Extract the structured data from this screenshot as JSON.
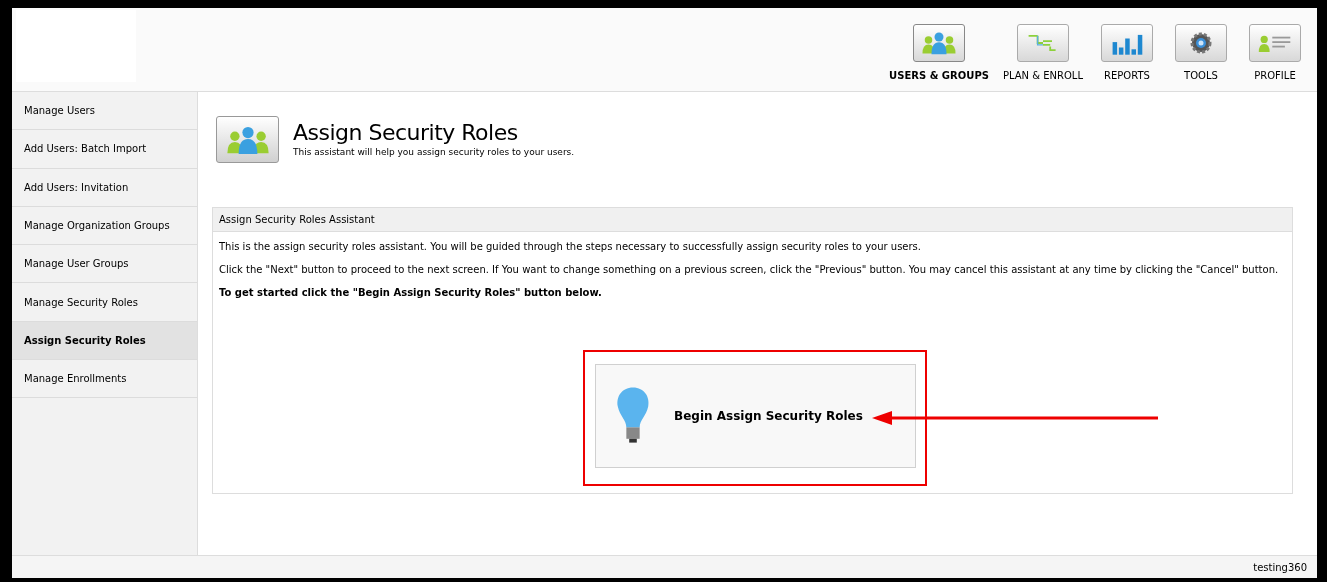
{
  "nav": [
    {
      "label": "USERS & GROUPS",
      "kind": "users",
      "selected": true
    },
    {
      "label": "PLAN & ENROLL",
      "kind": "plan",
      "selected": false
    },
    {
      "label": "REPORTS",
      "kind": "reports",
      "selected": false
    },
    {
      "label": "TOOLS",
      "kind": "tools",
      "selected": false
    },
    {
      "label": "PROFILE",
      "kind": "profile",
      "selected": false
    }
  ],
  "sidebar": {
    "items": [
      {
        "label": "Manage Users",
        "selected": false
      },
      {
        "label": "Add Users: Batch Import",
        "selected": false
      },
      {
        "label": "Add Users: Invitation",
        "selected": false
      },
      {
        "label": "Manage Organization Groups",
        "selected": false
      },
      {
        "label": "Manage User Groups",
        "selected": false
      },
      {
        "label": "Manage Security Roles",
        "selected": false
      },
      {
        "label": "Assign Security Roles",
        "selected": true
      },
      {
        "label": "Manage Enrollments",
        "selected": false
      }
    ]
  },
  "page": {
    "title": "Assign Security Roles",
    "subtitle": "This assistant will help you assign security roles to your users."
  },
  "panel": {
    "title": "Assign Security Roles Assistant",
    "paragraphs": [
      "This is the assign security roles assistant. You will be guided through the steps necessary to successfully assign security roles to your users.",
      "Click the \"Next\" button to proceed to the next screen. If You want to change something on a previous screen, click the \"Previous\" button. You may cancel this assistant at any time by clicking the \"Cancel\" button.",
      "**To get started click the \"Begin Assign Security Roles\" button below.**"
    ],
    "begin_button": "Begin Assign Security Roles"
  },
  "status_bar": {
    "user": "testing360"
  }
}
